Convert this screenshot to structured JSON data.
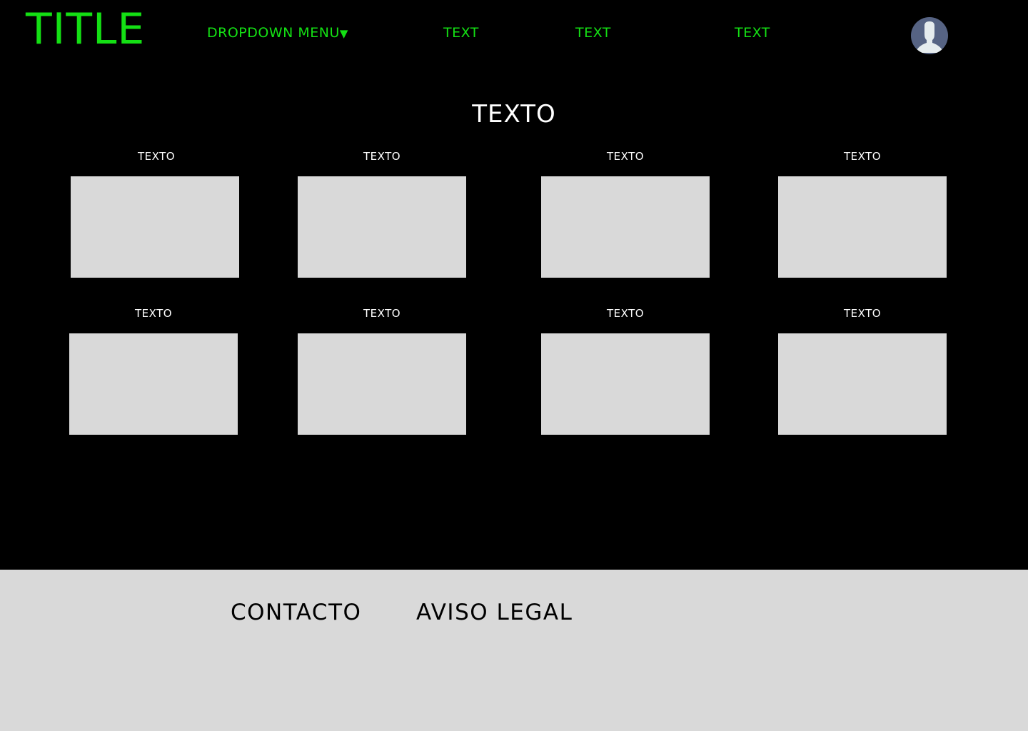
{
  "header": {
    "title": "TITLE",
    "dropdown_label": "DROPDOWN MENU",
    "dropdown_arrow": "▼",
    "nav": [
      "TEXT",
      "TEXT",
      "TEXT"
    ],
    "avatar_icon": "user-avatar-icon",
    "accent_color": "#14e014"
  },
  "main": {
    "heading": "TEXTO",
    "cards": [
      {
        "label": "TEXTO"
      },
      {
        "label": "TEXTO"
      },
      {
        "label": "TEXTO"
      },
      {
        "label": "TEXTO"
      },
      {
        "label": "TEXTO"
      },
      {
        "label": "TEXTO"
      },
      {
        "label": "TEXTO"
      },
      {
        "label": "TEXTO"
      }
    ]
  },
  "footer": {
    "links": [
      "CONTACTO",
      "AVISO LEGAL"
    ]
  }
}
